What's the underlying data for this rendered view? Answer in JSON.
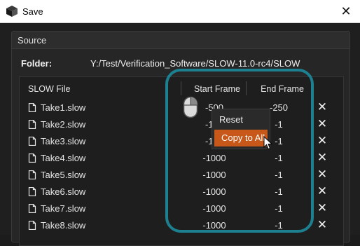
{
  "window": {
    "title": "Save",
    "close_glyph": "✕"
  },
  "source": {
    "title": "Source",
    "folder_label": "Folder:",
    "folder_path": "Y:/Test/Verification_Software/SLOW-11.0-rc4/SLOW"
  },
  "table": {
    "headers": {
      "file": "SLOW File",
      "start": "Start Frame",
      "end": "End Frame"
    },
    "remove_glyph": "✕",
    "rows": [
      {
        "file": "Take1.slow",
        "start": "-500",
        "end": "-250"
      },
      {
        "file": "Take2.slow",
        "start": "-100",
        "end": "-1"
      },
      {
        "file": "Take3.slow",
        "start": "-100",
        "end": "-1"
      },
      {
        "file": "Take4.slow",
        "start": "-1000",
        "end": "-1"
      },
      {
        "file": "Take5.slow",
        "start": "-1000",
        "end": "-1"
      },
      {
        "file": "Take6.slow",
        "start": "-1000",
        "end": "-1"
      },
      {
        "file": "Take7.slow",
        "start": "-1000",
        "end": "-1"
      },
      {
        "file": "Take8.slow",
        "start": "-1000",
        "end": "-1"
      }
    ]
  },
  "context_menu": {
    "items": [
      {
        "label": "Reset",
        "highlighted": false
      },
      {
        "label": "Copy to All",
        "highlighted": true
      }
    ]
  },
  "colors": {
    "highlight_ring": "#1d8091",
    "menu_highlight": "#c8571a",
    "background": "#1c1c1c"
  },
  "icons": {
    "app": "cube-icon",
    "file": "file-icon",
    "mouse": "mouse-right-click-icon",
    "cursor": "pointer-cursor-icon"
  }
}
